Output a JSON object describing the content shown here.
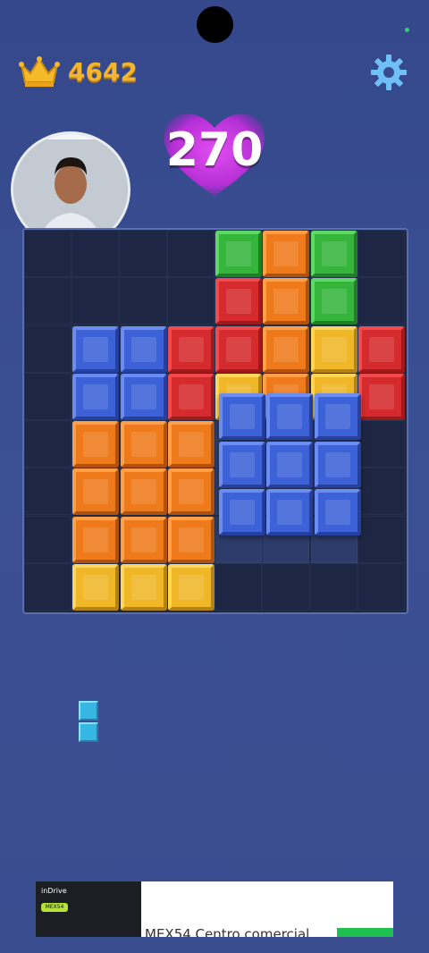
{
  "header": {
    "best_score": "4642",
    "current_score": "270",
    "icons": {
      "best": "crown-icon",
      "settings": "gear-icon",
      "score_bg": "heart-icon"
    }
  },
  "colors": {
    "red": "#d62b2e",
    "orange": "#ee7a1c",
    "yellow": "#f0b728",
    "green": "#36b53d",
    "blue": "#3d62d8",
    "board_bg": "#1d2744",
    "page_bg": "#3a4c8e",
    "best_score": "#f2b630",
    "heart": "#c838e0"
  },
  "board": {
    "size": 8,
    "rows": [
      [
        "",
        "",
        "",
        "",
        "green",
        "orange",
        "green",
        ""
      ],
      [
        "",
        "",
        "",
        "",
        "red",
        "orange",
        "green",
        ""
      ],
      [
        "",
        "blue",
        "blue",
        "red",
        "red",
        "orange",
        "yellow",
        "red"
      ],
      [
        "",
        "blue",
        "blue",
        "red",
        "yellow",
        "orange",
        "yellow",
        "red"
      ],
      [
        "",
        "orange",
        "orange",
        "orange",
        "",
        "",
        "",
        ""
      ],
      [
        "",
        "orange",
        "orange",
        "orange",
        "",
        "",
        "",
        ""
      ],
      [
        "",
        "orange",
        "orange",
        "orange",
        "",
        "",
        "",
        ""
      ],
      [
        "",
        "yellow",
        "yellow",
        "yellow",
        "",
        "",
        "",
        ""
      ]
    ],
    "dragging_piece": {
      "color": "blue",
      "rows": 3,
      "cols": 3,
      "over_row": 3.5,
      "over_col": 4
    }
  },
  "tray": {
    "piece": {
      "color": "cyan",
      "cells": 2,
      "orientation": "vertical"
    }
  },
  "ad": {
    "brand": "inDrive",
    "tag": "MEX54",
    "text": "MEX54 Centro comercial"
  }
}
